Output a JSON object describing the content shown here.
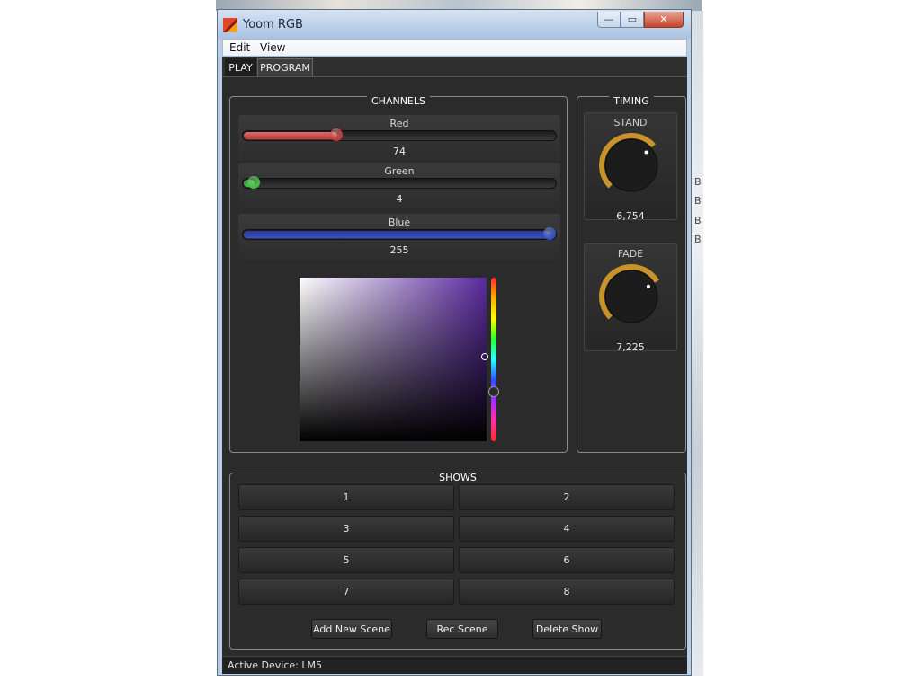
{
  "window": {
    "title": "Yoom RGB",
    "buttons": {
      "minimize": "—",
      "maximize": "▭",
      "close": "✕"
    }
  },
  "menu": [
    "Edit",
    "View"
  ],
  "tabs": [
    {
      "label": "PLAY",
      "active": false
    },
    {
      "label": "PROGRAM",
      "active": true
    }
  ],
  "channels": {
    "title": "CHANNELS",
    "items": [
      {
        "name": "Red",
        "value": "74",
        "level": 74,
        "max": 255,
        "color": "#c23a3a",
        "fill": "#d96a6a"
      },
      {
        "name": "Green",
        "value": "4",
        "level": 4,
        "max": 255,
        "color": "#3fbf3f",
        "fill": "#2f8f2f"
      },
      {
        "name": "Blue",
        "value": "255",
        "level": 255,
        "max": 255,
        "color": "#3450c8",
        "fill": "#2b3a9a"
      }
    ]
  },
  "color_picker": {
    "selection_hex": "#4a04ff",
    "hue_fraction": 0.7
  },
  "timing": {
    "title": "TIMING",
    "items": [
      {
        "label": "STAND",
        "value": "6,754",
        "fraction": 0.68
      },
      {
        "label": "FADE",
        "value": "7,225",
        "fraction": 0.72
      }
    ],
    "accent": "#c8932a"
  },
  "shows": {
    "title": "SHOWS",
    "buttons": [
      "1",
      "2",
      "3",
      "4",
      "5",
      "6",
      "7",
      "8"
    ],
    "actions": [
      "Add New Scene",
      "Rec Scene",
      "Delete Show"
    ]
  },
  "status": {
    "text": "Active Device: LM5"
  },
  "background_fragments": [
    "B",
    "B",
    "B",
    "B"
  ]
}
